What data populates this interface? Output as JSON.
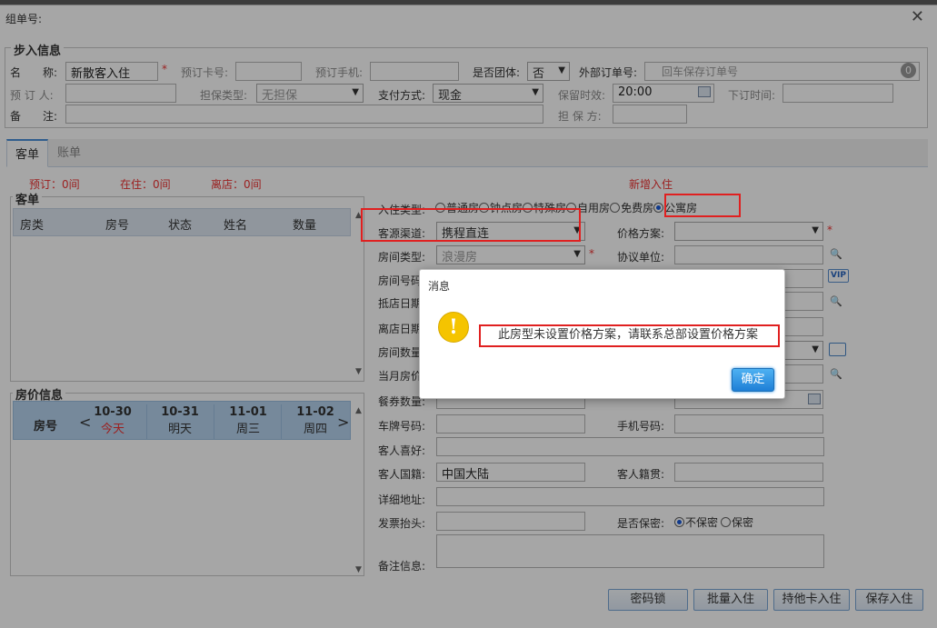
{
  "window": {
    "title": "组单号:",
    "close": "✕"
  },
  "intake": {
    "legend": "步入信息",
    "name_label": "名　　称:",
    "name_value": "新散客入住",
    "card_no_label": "预订卡号:",
    "phone_label": "预订手机:",
    "group_label": "是否团体:",
    "group_value": "否",
    "ext_order_label": "外部订单号:",
    "ext_order_placeholder": "回车保存订单号",
    "ext_order_badge": "0",
    "booker_label": "预 订 人:",
    "guarantee_label": "担保类型:",
    "guarantee_value": "无担保",
    "pay_label": "支付方式:",
    "pay_value": "现金",
    "hold_label": "保留时效:",
    "hold_value": "20:00",
    "order_time_label": "下订时间:",
    "remark_label": "备　　注:",
    "guarantor_label": "担 保 方:"
  },
  "tabs": [
    {
      "label": "客单"
    },
    {
      "label": "账单"
    }
  ],
  "stats": {
    "reserved": "预订：0间",
    "in_house": "在住：0间",
    "departed": "离店：0间",
    "new_checkin": "新增入住"
  },
  "guest_list": {
    "legend": "客单",
    "columns": [
      "房类",
      "房号",
      "状态",
      "姓名",
      "数量"
    ]
  },
  "room_price": {
    "legend": "房价信息",
    "col_label": "房号",
    "dates": [
      {
        "date": "10-30",
        "day": "今天"
      },
      {
        "date": "10-31",
        "day": "明天"
      },
      {
        "date": "11-01",
        "day": "周三"
      },
      {
        "date": "11-02",
        "day": "周四"
      }
    ]
  },
  "form": {
    "checkin_type_label": "入住类型:",
    "checkin_types": [
      "普通房",
      "钟点房",
      "特殊房",
      "自用房",
      "免费房",
      "公寓房"
    ],
    "checkin_type_selected": "公寓房",
    "source_label": "客源渠道:",
    "source_value": "携程直连",
    "price_plan_label": "价格方案:",
    "room_type_label": "房间类型:",
    "room_type_value": "浪漫房",
    "agreement_label": "协议单位:",
    "room_no_label": "房间号码:",
    "arrival_label": "抵店日期:",
    "departure_label": "离店日期:",
    "room_count_label": "房间数量:",
    "month_price_label": "当月房价:",
    "meal_label": "餐券数量:",
    "plate_label": "车牌号码:",
    "mobile_label": "手机号码:",
    "pref_label": "客人喜好:",
    "nationality_label": "客人国籍:",
    "nationality_value": "中国大陆",
    "origin_label": "客人籍贯:",
    "address_label": "详细地址:",
    "invoice_label": "发票抬头:",
    "confidential_label": "是否保密:",
    "confidential_options": [
      "不保密",
      "保密"
    ],
    "notes_label": "备注信息:"
  },
  "buttons": {
    "pwd_lock": "密码锁",
    "batch": "批量入住",
    "other_card": "持他卡入住",
    "save": "保存入住"
  },
  "dialog": {
    "title": "消息",
    "message": "此房型未设置价格方案，请联系总部设置价格方案",
    "ok": "确定"
  },
  "colors": {
    "accent": "#1e7fd6",
    "highlight": "#e02020",
    "grid_header": "#dde6f1",
    "price_header": "#b5d3ee"
  }
}
